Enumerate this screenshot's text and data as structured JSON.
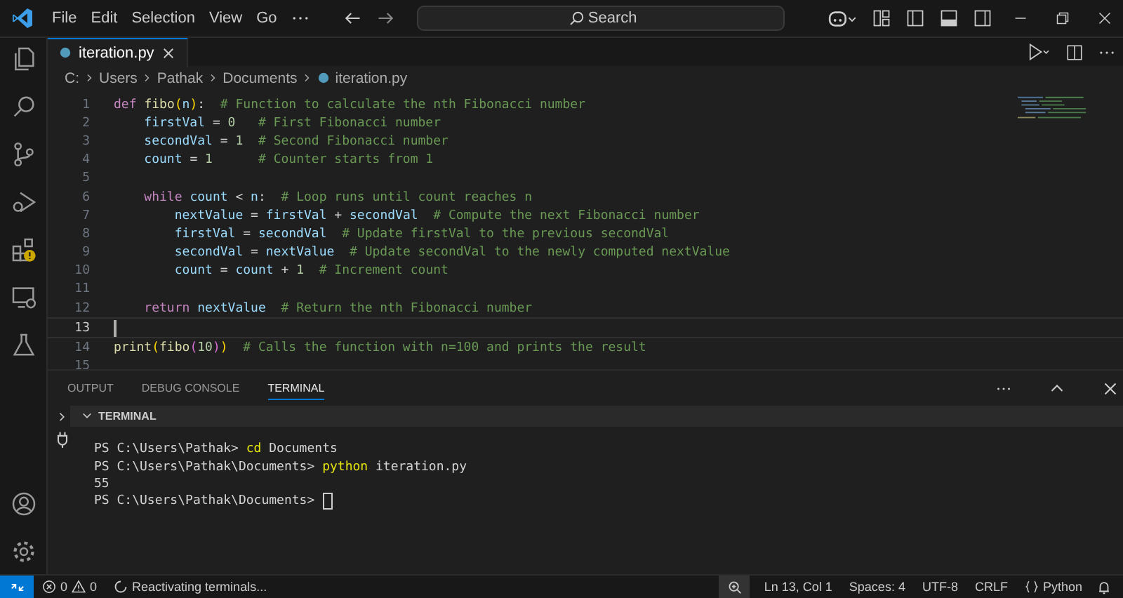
{
  "menu": [
    "File",
    "Edit",
    "Selection",
    "View",
    "Go"
  ],
  "search": {
    "placeholder": "Search"
  },
  "tabs": [
    {
      "label": "iteration.py",
      "selected": true
    }
  ],
  "breadcrumb": [
    "C:",
    "Users",
    "Pathak",
    "Documents",
    "iteration.py"
  ],
  "code": [
    {
      "number": "1",
      "current": false,
      "tokens": [
        {
          "kind": "keyword",
          "text": "def "
        },
        {
          "kind": "func",
          "text": "fibo"
        },
        {
          "kind": "paren",
          "text": "("
        },
        {
          "kind": "var",
          "text": "n"
        },
        {
          "kind": "paren",
          "text": ")"
        },
        {
          "kind": "plain",
          "text": ":"
        },
        {
          "kind": "comment",
          "text": "  # Function to calculate the nth Fibonacci number"
        }
      ]
    },
    {
      "number": "2",
      "current": false,
      "tokens": [
        {
          "kind": "var",
          "text": "    firstVal"
        },
        {
          "kind": "plain",
          "text": " = "
        },
        {
          "kind": "num",
          "text": "0"
        },
        {
          "kind": "comment",
          "text": "   # First Fibonacci number"
        }
      ]
    },
    {
      "number": "3",
      "current": false,
      "tokens": [
        {
          "kind": "var",
          "text": "    secondVal"
        },
        {
          "kind": "plain",
          "text": " = "
        },
        {
          "kind": "num",
          "text": "1"
        },
        {
          "kind": "comment",
          "text": "  # Second Fibonacci number"
        }
      ]
    },
    {
      "number": "4",
      "current": false,
      "tokens": [
        {
          "kind": "var",
          "text": "    count"
        },
        {
          "kind": "plain",
          "text": " = "
        },
        {
          "kind": "num",
          "text": "1"
        },
        {
          "kind": "comment",
          "text": "      # Counter starts from 1"
        }
      ]
    },
    {
      "number": "5",
      "current": false
    },
    {
      "number": "6",
      "current": false,
      "tokens": [
        {
          "kind": "keyword",
          "text": "    while "
        },
        {
          "kind": "var",
          "text": "count"
        },
        {
          "kind": "plain",
          "text": " < "
        },
        {
          "kind": "var",
          "text": "n"
        },
        {
          "kind": "plain",
          "text": ":"
        },
        {
          "kind": "comment",
          "text": "  # Loop runs until count reaches n"
        }
      ]
    },
    {
      "number": "7",
      "current": false,
      "tokens": [
        {
          "kind": "var",
          "text": "        nextValue"
        },
        {
          "kind": "plain",
          "text": " = "
        },
        {
          "kind": "var",
          "text": "firstVal"
        },
        {
          "kind": "plain",
          "text": " + "
        },
        {
          "kind": "var",
          "text": "secondVal"
        },
        {
          "kind": "comment",
          "text": "  # Compute the next Fibonacci number"
        }
      ]
    },
    {
      "number": "8",
      "current": false,
      "tokens": [
        {
          "kind": "var",
          "text": "        firstVal"
        },
        {
          "kind": "plain",
          "text": " = "
        },
        {
          "kind": "var",
          "text": "secondVal"
        },
        {
          "kind": "comment",
          "text": "  # Update firstVal to the previous secondVal"
        }
      ]
    },
    {
      "number": "9",
      "current": false,
      "tokens": [
        {
          "kind": "var",
          "text": "        secondVal"
        },
        {
          "kind": "plain",
          "text": " = "
        },
        {
          "kind": "var",
          "text": "nextValue"
        },
        {
          "kind": "comment",
          "text": "  # Update secondVal to the newly computed nextValue"
        }
      ]
    },
    {
      "number": "10",
      "current": false,
      "tokens": [
        {
          "kind": "var",
          "text": "        count"
        },
        {
          "kind": "plain",
          "text": " = "
        },
        {
          "kind": "var",
          "text": "count"
        },
        {
          "kind": "plain",
          "text": " + "
        },
        {
          "kind": "num",
          "text": "1"
        },
        {
          "kind": "comment",
          "text": "  # Increment count"
        }
      ]
    },
    {
      "number": "11",
      "current": false
    },
    {
      "number": "12",
      "current": false,
      "tokens": [
        {
          "kind": "keyword",
          "text": "    return "
        },
        {
          "kind": "var",
          "text": "nextValue"
        },
        {
          "kind": "comment",
          "text": "  # Return the nth Fibonacci number"
        }
      ]
    },
    {
      "number": "13",
      "current": true
    },
    {
      "number": "14",
      "current": false,
      "tokens": [
        {
          "kind": "func",
          "text": "print"
        },
        {
          "kind": "paren",
          "text": "("
        },
        {
          "kind": "func",
          "text": "fibo"
        },
        {
          "kind": "paren2",
          "text": "("
        },
        {
          "kind": "num",
          "text": "10"
        },
        {
          "kind": "paren2",
          "text": ")"
        },
        {
          "kind": "paren",
          "text": ")"
        },
        {
          "kind": "comment",
          "text": "  # Calls the function with n=100 and prints the result"
        }
      ]
    },
    {
      "number": "15",
      "current": false
    }
  ],
  "panel_tabs": [
    {
      "label": "OUTPUT",
      "selected": false
    },
    {
      "label": "DEBUG CONSOLE",
      "selected": false
    },
    {
      "label": "TERMINAL",
      "selected": true
    }
  ],
  "terminal": {
    "title": "TERMINAL",
    "lines": [
      {
        "tokens": [
          {
            "kind": "plain",
            "text": "PS C:\\Users\\Pathak> "
          },
          {
            "kind": "command",
            "text": "cd"
          },
          {
            "kind": "plain",
            "text": " Documents"
          }
        ]
      },
      {
        "tokens": [
          {
            "kind": "plain",
            "text": "PS C:\\Users\\Pathak\\Documents> "
          },
          {
            "kind": "command",
            "text": "python"
          },
          {
            "kind": "plain",
            "text": " iteration.py"
          }
        ]
      },
      {
        "tokens": [
          {
            "kind": "plain",
            "text": "55"
          }
        ]
      },
      {
        "tokens": [
          {
            "kind": "plain",
            "text": "PS C:\\Users\\Pathak\\Documents> "
          }
        ],
        "cursor": true
      }
    ]
  },
  "status_bar": {
    "errors": "0",
    "warnings": "0",
    "message": "Reactivating terminals...",
    "position": "Ln 13, Col 1",
    "spaces": "Spaces: 4",
    "encoding": "UTF-8",
    "eol": "CRLF",
    "language": "Python"
  }
}
